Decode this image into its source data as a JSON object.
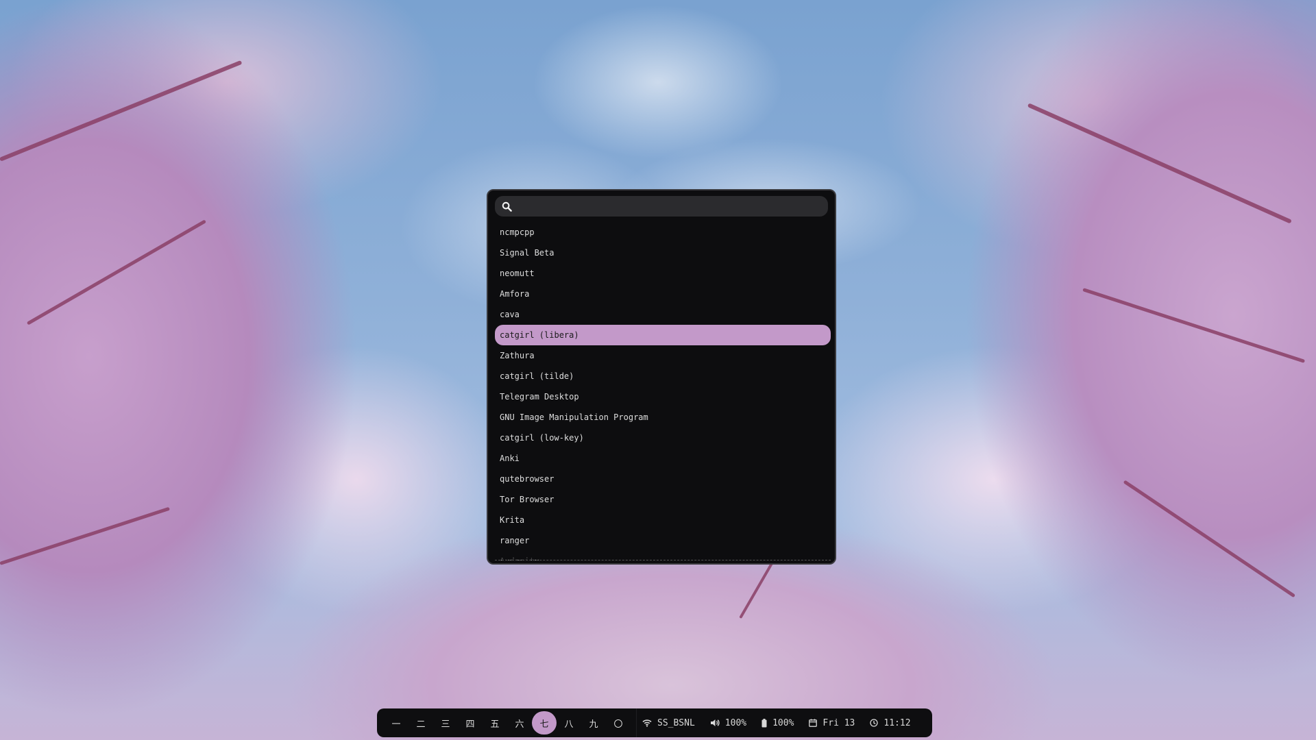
{
  "launcher": {
    "search": {
      "placeholder": "",
      "value": ""
    },
    "results": [
      "ncmpcpp",
      "Signal Beta",
      "neomutt",
      "Amfora",
      "cava",
      "catgirl (libera)",
      "Zathura",
      "catgirl (tilde)",
      "Telegram Desktop",
      "GNU Image Manipulation Program",
      "catgirl (low-key)",
      "Anki",
      "qutebrowser",
      "Tor Browser",
      "Krita",
      "ranger",
      "Audacity"
    ],
    "selected_index": 5,
    "accent": "#c399c9"
  },
  "bar": {
    "workspaces": [
      "一",
      "二",
      "三",
      "四",
      "五",
      "六",
      "七",
      "八",
      "九",
      "〇"
    ],
    "active_workspace_index": 6,
    "wifi": {
      "icon": "wifi-icon",
      "label": "SS_BSNL"
    },
    "volume": {
      "icon": "volume-icon",
      "label": "100%"
    },
    "battery": {
      "icon": "battery-icon",
      "label": "100%"
    },
    "date": {
      "icon": "calendar-icon",
      "label": "Fri 13"
    },
    "clock": {
      "icon": "clock-icon",
      "label": "11:12"
    }
  }
}
